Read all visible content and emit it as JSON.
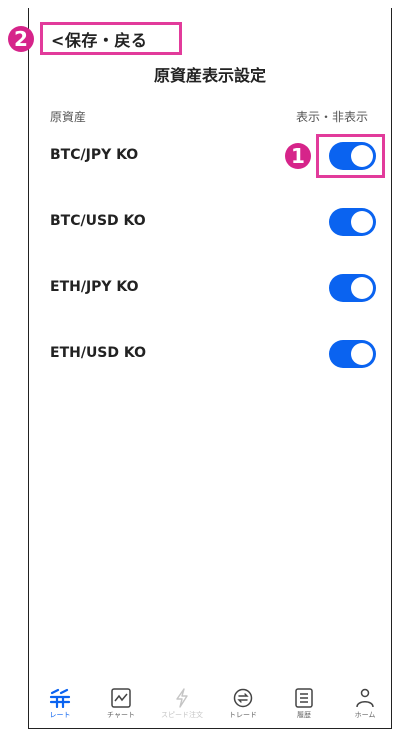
{
  "header": {
    "back_label": "<保存・戻る",
    "title": "原資産表示設定"
  },
  "annotations": {
    "marker_1": "1",
    "marker_2": "2"
  },
  "table": {
    "col_asset": "原資産",
    "col_visibility": "表示・非表示",
    "rows": [
      {
        "label": "BTC/JPY KO",
        "enabled": true
      },
      {
        "label": "BTC/USD KO",
        "enabled": true
      },
      {
        "label": "ETH/JPY KO",
        "enabled": true
      },
      {
        "label": "ETH/USD KO",
        "enabled": true
      }
    ]
  },
  "colors": {
    "accent": "#0a63f0",
    "highlight": "#e23b9b"
  },
  "bottom_nav": [
    {
      "label": "レート",
      "icon": "rate-icon",
      "state": "active"
    },
    {
      "label": "チャート",
      "icon": "chart-icon",
      "state": "normal"
    },
    {
      "label": "スピード注文",
      "icon": "lightning-icon",
      "state": "disabled"
    },
    {
      "label": "トレード",
      "icon": "trade-icon",
      "state": "normal"
    },
    {
      "label": "履歴",
      "icon": "history-icon",
      "state": "normal"
    },
    {
      "label": "ホーム",
      "icon": "home-icon",
      "state": "normal"
    }
  ]
}
